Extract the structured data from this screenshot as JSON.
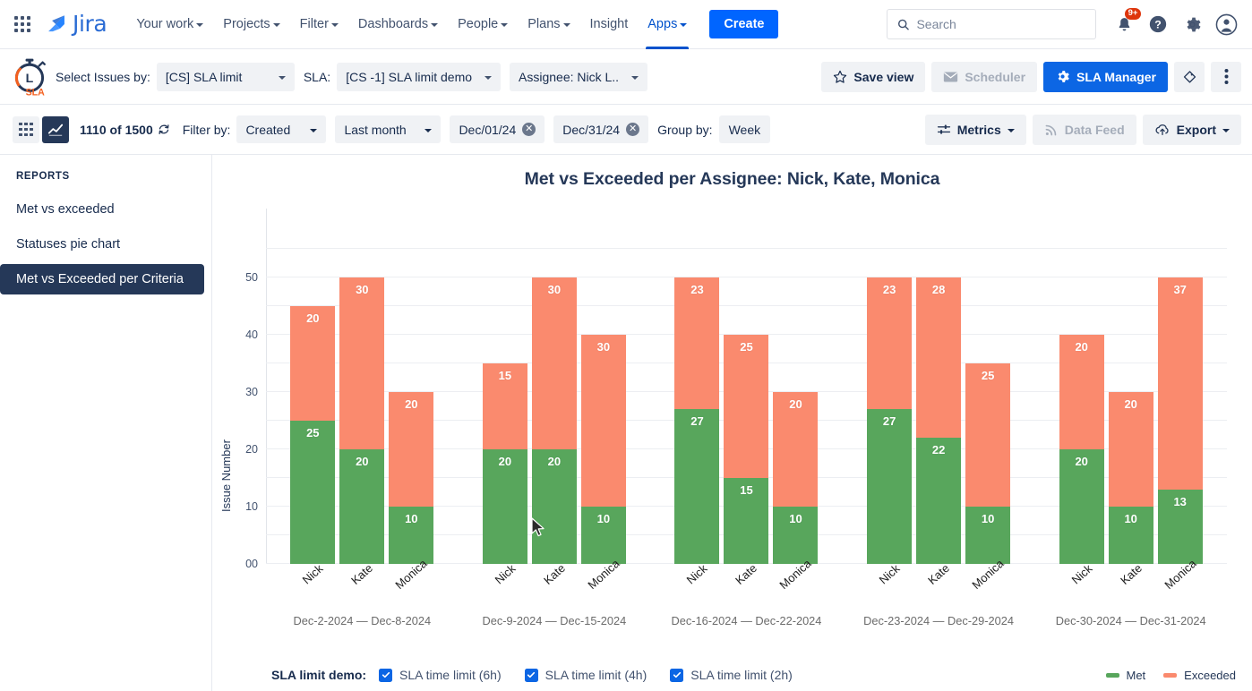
{
  "topnav": {
    "apps_grid_icon": "apps-grid-icon",
    "logo_text": "Jira",
    "items": [
      {
        "label": "Your work",
        "has_caret": true,
        "active": false
      },
      {
        "label": "Projects",
        "has_caret": true,
        "active": false
      },
      {
        "label": "Filter",
        "has_caret": true,
        "active": false
      },
      {
        "label": "Dashboards",
        "has_caret": true,
        "active": false
      },
      {
        "label": "People",
        "has_caret": true,
        "active": false
      },
      {
        "label": "Plans",
        "has_caret": true,
        "active": false
      },
      {
        "label": "Insight",
        "has_caret": false,
        "active": false
      },
      {
        "label": "Apps",
        "has_caret": true,
        "active": true
      }
    ],
    "create_label": "Create",
    "search_placeholder": "Search",
    "search_value": "",
    "notification_badge": "9+",
    "icons": [
      "search-icon",
      "notifications-bell-icon",
      "help-icon",
      "settings-gear-icon",
      "user-avatar-icon"
    ]
  },
  "sla_toolbar": {
    "logo_text": "SLA",
    "select_issues_label": "Select Issues by:",
    "select_issues_value": "[CS] SLA limit",
    "sla_label": "SLA:",
    "sla_value": "[CS -1] SLA limit demo",
    "assignee_value": "Assignee: Nick L..",
    "save_view_label": "Save view",
    "scheduler_label": "Scheduler",
    "scheduler_disabled": true,
    "sla_manager_label": "SLA Manager",
    "icons": [
      "star-icon",
      "envelope-icon",
      "gear-icon",
      "tag-icon",
      "more-vertical-icon"
    ]
  },
  "filter_bar": {
    "count_text": "1110 of 1500",
    "filter_by_label": "Filter by:",
    "filter_by_value": "Created",
    "period_value": "Last month",
    "date_from": "Dec/01/24",
    "date_to": "Dec/31/24",
    "group_by_label": "Group by:",
    "group_by_value": "Week",
    "metrics_label": "Metrics",
    "data_feed_label": "Data Feed",
    "data_feed_disabled": true,
    "export_label": "Export",
    "icons": [
      "table-view-icon",
      "chart-view-icon",
      "refresh-icon",
      "sliders-icon",
      "rss-icon",
      "cloud-upload-icon"
    ]
  },
  "sidebar": {
    "heading": "REPORTS",
    "items": [
      {
        "label": "Met vs exceeded",
        "active": false
      },
      {
        "label": "Statuses pie chart",
        "active": false
      },
      {
        "label": "Met vs Exceeded per Criteria",
        "active": true
      }
    ]
  },
  "footer": {
    "legend_label": "SLA limit demo:",
    "checkboxes": [
      {
        "label": "SLA time limit (6h)",
        "checked": true
      },
      {
        "label": "SLA time limit (4h)",
        "checked": true
      },
      {
        "label": "SLA time limit (2h)",
        "checked": true
      }
    ],
    "legend": [
      {
        "label": "Met",
        "color": "#58a65c"
      },
      {
        "label": "Exceeded",
        "color": "#fa8a6e"
      }
    ]
  },
  "colors": {
    "met": "#58a65c",
    "exceeded": "#fa8a6e",
    "accent": "#0c66e4",
    "sidebar_active": "#253858",
    "badge_red": "#de350b"
  },
  "chart_data": {
    "type": "bar",
    "subtype": "stacked-grouped",
    "title": "Met vs Exceeded per Assignee: Nick, Kate, Monica",
    "xlabel": "",
    "ylabel": "Issue Number",
    "ylim": [
      0,
      55
    ],
    "ytick_values": [
      0,
      10,
      20,
      30,
      40,
      50
    ],
    "ytick_labels": [
      "00",
      "10",
      "20",
      "30",
      "40",
      "50"
    ],
    "gridline_step": 5,
    "grid": true,
    "legend_position": "bottom-right",
    "assignees": [
      "Nick",
      "Kate",
      "Monica"
    ],
    "series": [
      {
        "name": "Met",
        "color": "#58a65c"
      },
      {
        "name": "Exceeded",
        "color": "#fa8a6e"
      }
    ],
    "groups": [
      {
        "range": "Dec-2-2024 — Dec-8-2024",
        "bars": [
          {
            "assignee": "Nick",
            "met": 25,
            "exceeded": 20,
            "total": 45
          },
          {
            "assignee": "Kate",
            "met": 20,
            "exceeded": 30,
            "total": 50
          },
          {
            "assignee": "Monica",
            "met": 10,
            "exceeded": 20,
            "total": 30
          }
        ]
      },
      {
        "range": "Dec-9-2024 — Dec-15-2024",
        "bars": [
          {
            "assignee": "Nick",
            "met": 20,
            "exceeded": 15,
            "total": 35
          },
          {
            "assignee": "Kate",
            "met": 20,
            "exceeded": 30,
            "total": 50
          },
          {
            "assignee": "Monica",
            "met": 10,
            "exceeded": 30,
            "total": 40
          }
        ]
      },
      {
        "range": "Dec-16-2024 — Dec-22-2024",
        "bars": [
          {
            "assignee": "Nick",
            "met": 27,
            "exceeded": 23,
            "total": 50
          },
          {
            "assignee": "Kate",
            "met": 15,
            "exceeded": 25,
            "total": 40
          },
          {
            "assignee": "Monica",
            "met": 10,
            "exceeded": 20,
            "total": 30
          }
        ]
      },
      {
        "range": "Dec-23-2024 — Dec-29-2024",
        "bars": [
          {
            "assignee": "Nick",
            "met": 27,
            "exceeded": 23,
            "total": 50
          },
          {
            "assignee": "Kate",
            "met": 22,
            "exceeded": 28,
            "total": 50
          },
          {
            "assignee": "Monica",
            "met": 10,
            "exceeded": 25,
            "total": 35
          }
        ]
      },
      {
        "range": "Dec-30-2024 — Dec-31-2024",
        "bars": [
          {
            "assignee": "Nick",
            "met": 20,
            "exceeded": 20,
            "total": 40
          },
          {
            "assignee": "Kate",
            "met": 10,
            "exceeded": 20,
            "total": 30
          },
          {
            "assignee": "Monica",
            "met": 13,
            "exceeded": 37,
            "total": 50
          }
        ]
      }
    ]
  }
}
